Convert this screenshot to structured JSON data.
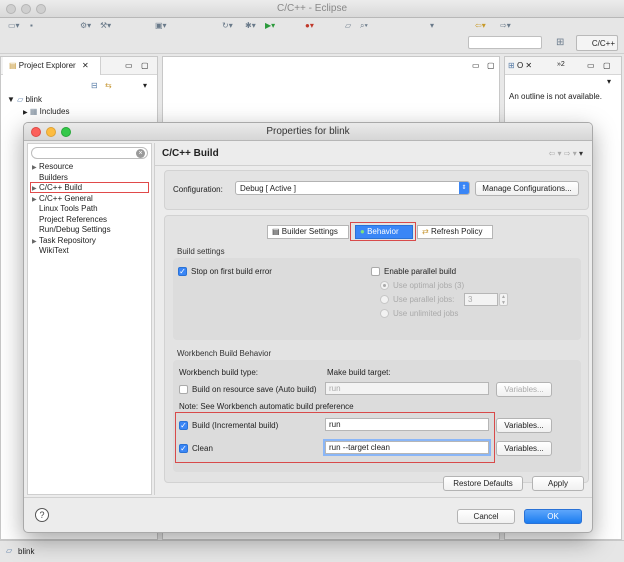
{
  "app": {
    "title": "C/C++ - Eclipse",
    "perspective": "C/C++",
    "status_text": "blink"
  },
  "explorer": {
    "tab_label": "Project Explorer",
    "project": "blink",
    "includes": "Includes"
  },
  "outline": {
    "tab_label": "O",
    "overflow": "»2",
    "message": "An outline is not available."
  },
  "dialog": {
    "title": "Properties for blink",
    "nav_items": [
      {
        "label": "Resource",
        "arrow": "▶"
      },
      {
        "label": "Builders",
        "arrow": ""
      },
      {
        "label": "C/C++ Build",
        "arrow": "▶"
      },
      {
        "label": "C/C++ General",
        "arrow": "▶"
      },
      {
        "label": "Linux Tools Path",
        "arrow": ""
      },
      {
        "label": "Project References",
        "arrow": ""
      },
      {
        "label": "Run/Debug Settings",
        "arrow": ""
      },
      {
        "label": "Task Repository",
        "arrow": "▶"
      },
      {
        "label": "WikiText",
        "arrow": ""
      }
    ],
    "page_title": "C/C++ Build",
    "configuration_label": "Configuration:",
    "configuration_value": "Debug  [ Active ]",
    "manage_button": "Manage Configurations...",
    "tabs": [
      "Builder Settings",
      "Behavior",
      "Refresh Policy"
    ],
    "build_settings": {
      "heading": "Build settings",
      "stop_on_error": "Stop on first build error",
      "parallel": "Enable parallel build",
      "optimal_jobs": "Use optimal jobs (3)",
      "parallel_jobs": "Use parallel jobs:",
      "parallel_jobs_value": "3",
      "unlimited_jobs": "Use unlimited jobs"
    },
    "workbench": {
      "heading": "Workbench Build Behavior",
      "type_header": "Workbench build type:",
      "target_header": "Make build target:",
      "auto_build": "Build on resource save (Auto build)",
      "auto_build_target": "run",
      "note": "Note: See Workbench automatic build preference",
      "incremental": "Build (Incremental build)",
      "incremental_target": "run",
      "clean": "Clean",
      "clean_target": "run --target clean",
      "variables": "Variables..."
    },
    "restore_defaults": "Restore Defaults",
    "apply": "Apply",
    "cancel": "Cancel",
    "ok": "OK"
  }
}
